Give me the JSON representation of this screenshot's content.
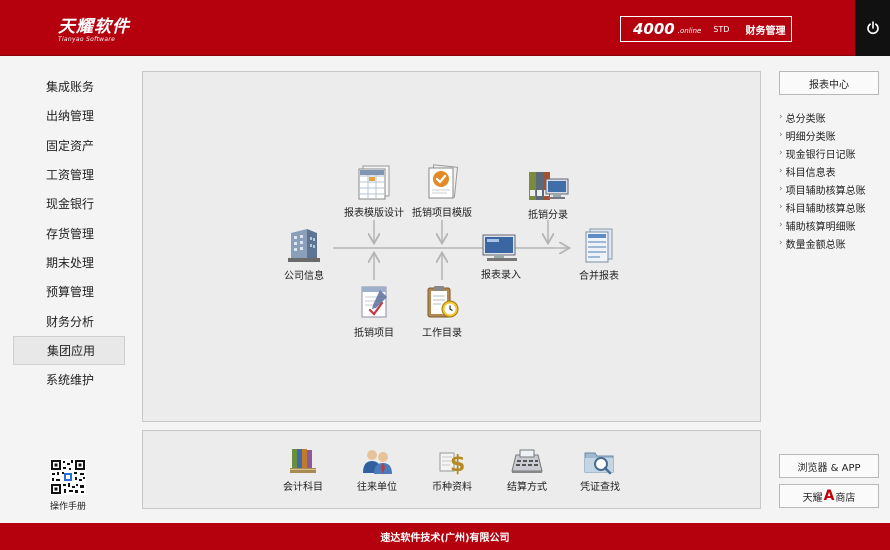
{
  "header": {
    "logo_cn": "天耀软件",
    "logo_en": "Tianyao Software",
    "product_number": "4000",
    "product_suffix": ".online",
    "product_edition": "STD",
    "product_name": "财务管理"
  },
  "nav": {
    "items": [
      {
        "label": "集成账务"
      },
      {
        "label": "出纳管理"
      },
      {
        "label": "固定资产"
      },
      {
        "label": "工资管理"
      },
      {
        "label": "现金银行"
      },
      {
        "label": "存货管理"
      },
      {
        "label": "期末处理"
      },
      {
        "label": "预算管理"
      },
      {
        "label": "财务分析"
      },
      {
        "label": "集团应用",
        "active": true
      },
      {
        "label": "系统维护"
      }
    ],
    "qr_label": "操作手册"
  },
  "flow": {
    "company_info": "公司信息",
    "report_template_design": "报表模版设计",
    "elim_template": "抵销项目模版",
    "elim_entries": "抵销分录",
    "report_entry": "报表录入",
    "consolidated_report": "合并报表",
    "elim_item": "抵销项目",
    "work_directory": "工作目录"
  },
  "bottom": {
    "items": [
      {
        "label": "会计科目",
        "icon": "ledger-books-icon"
      },
      {
        "label": "往来单位",
        "icon": "people-icon"
      },
      {
        "label": "币种资料",
        "icon": "currency-icon"
      },
      {
        "label": "结算方式",
        "icon": "calculator-icon"
      },
      {
        "label": "凭证查找",
        "icon": "folder-search-icon"
      }
    ]
  },
  "right": {
    "report_center": "报表中心",
    "reports": [
      {
        "label": "总分类账"
      },
      {
        "label": "明细分类账"
      },
      {
        "label": "现金银行日记账"
      },
      {
        "label": "科目信息表"
      },
      {
        "label": "项目辅助核算总账"
      },
      {
        "label": "科目辅助核算总账"
      },
      {
        "label": "辅助核算明细账"
      },
      {
        "label": "数量金额总账"
      }
    ],
    "browser_app": "浏览器 & APP",
    "store_prefix": "天耀",
    "store_letter": "A",
    "store_suffix": "商店"
  },
  "footer": {
    "company": "速达软件技术(广州)有限公司"
  },
  "colors": {
    "brand_red": "#b5000d",
    "panel_bg": "#ececec",
    "page_bg": "#f4f4f4"
  }
}
